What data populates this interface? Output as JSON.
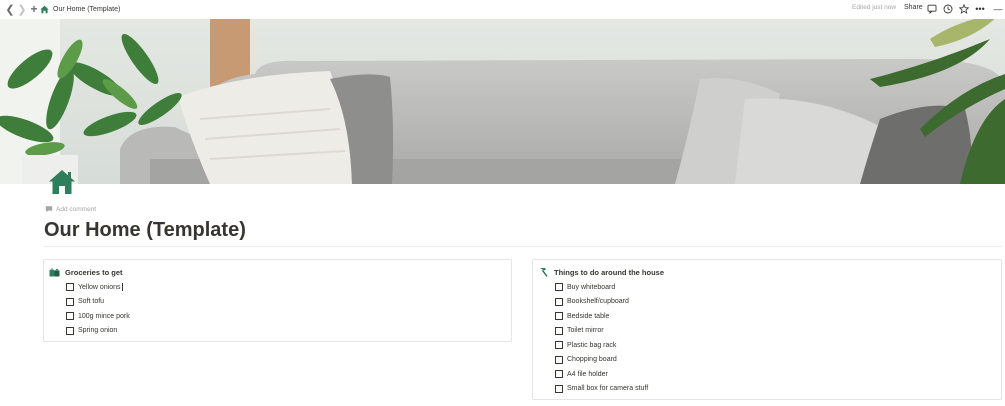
{
  "topbar": {
    "breadcrumb_title": "Our Home (Template)",
    "edited_text": "Edited just now",
    "share_label": "Share",
    "more_label": "•••",
    "dash_label": "—"
  },
  "page": {
    "add_comment_label": "Add comment",
    "title": "Our Home (Template)"
  },
  "cards": {
    "groceries": {
      "heading": "Groceries to get",
      "items": [
        {
          "label": "Yellow onions",
          "checked": false
        },
        {
          "label": "Soft tofu",
          "checked": false
        },
        {
          "label": "100g mince pork",
          "checked": false
        },
        {
          "label": "Spring onion",
          "checked": false
        }
      ]
    },
    "house": {
      "heading": "Things to do around the house",
      "items": [
        {
          "label": "Buy whiteboard",
          "checked": false
        },
        {
          "label": "Bookshelf/cupboard",
          "checked": false
        },
        {
          "label": "Bedside table",
          "checked": false
        },
        {
          "label": "Toilet mirror",
          "checked": false
        },
        {
          "label": "Plastic bag rack",
          "checked": false
        },
        {
          "label": "Chopping board",
          "checked": false
        },
        {
          "label": "A4 file holder",
          "checked": false
        },
        {
          "label": "Small box for camera stuff",
          "checked": false
        }
      ]
    }
  },
  "colors": {
    "text": "#37352f",
    "muted": "#a5a5a3",
    "home_icon": "#2e7d5b",
    "border": "#e5e5e3"
  },
  "icons": {
    "page_icon": "house-icon",
    "groceries_icon": "shopping-bags-icon",
    "house_icon": "hammer-icon"
  }
}
